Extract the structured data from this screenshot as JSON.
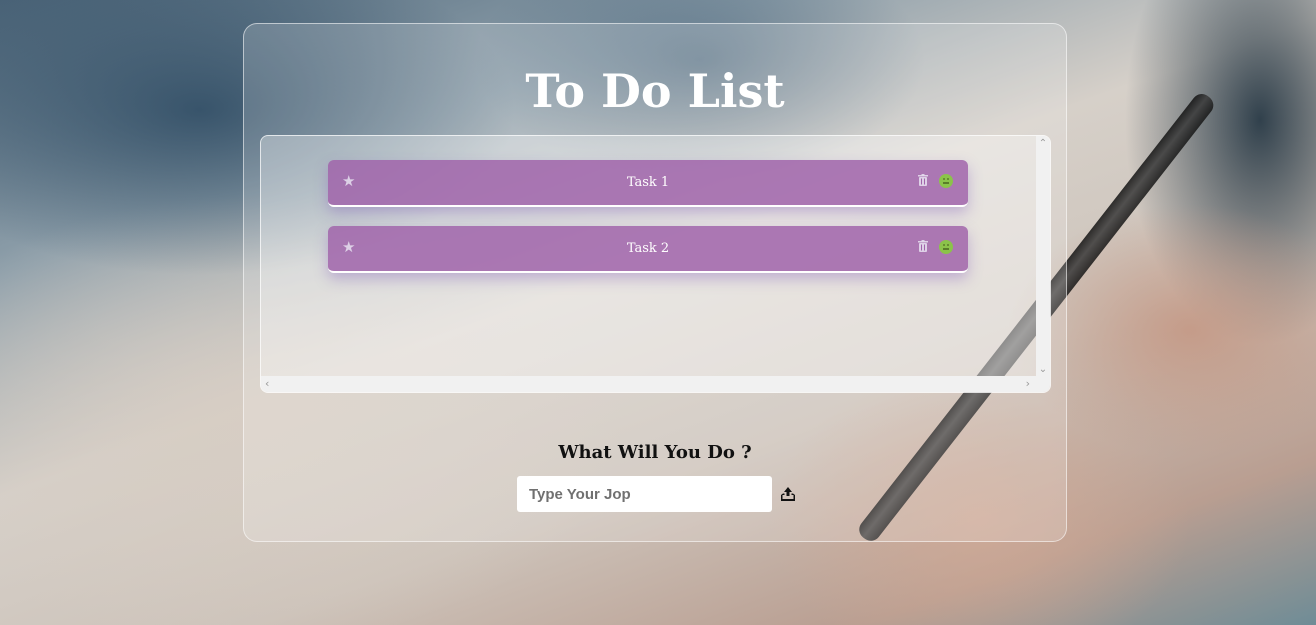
{
  "app": {
    "title": "To Do List"
  },
  "tasks": [
    {
      "label": "Task 1"
    },
    {
      "label": "Task 2"
    }
  ],
  "form": {
    "prompt": "What Will You Do ?",
    "placeholder": "Type Your Jop",
    "value": ""
  },
  "icons": {
    "star": "star-icon",
    "delete": "trash-icon",
    "status": "status-face-icon",
    "add": "upload-tray-icon"
  },
  "colors": {
    "task_background": "#a064aa",
    "status_green": "#8bc34a",
    "title_text": "#ffffff",
    "prompt_text": "#111111"
  }
}
